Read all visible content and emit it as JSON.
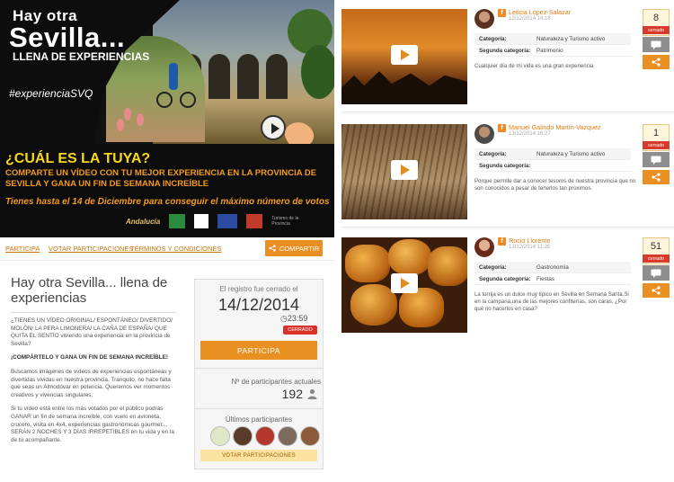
{
  "banner": {
    "line1": "Hay otra",
    "line2": "Sevilla...",
    "line3": "LLENA DE EXPERIENCIAS",
    "hashtag": "#experienciaSVQ",
    "question": "¿CUÁL ES LA TUYA?",
    "subtitle": "COMPARTE UN VÍDEO CON TU MEJOR EXPERIENCIA EN LA PROVINCIA DE SEVILLA Y GANA UN FIN DE SEMANA INCREÍBLE",
    "deadline": "Tienes hasta el 14 de Diciembre para conseguir el máximo número de votos",
    "logo_andalucia": "Andalucía",
    "logo_turismo": "Turismo de la Provincia"
  },
  "nav": {
    "participa": "PARTICIPA",
    "votar": "VOTAR PARTICIPACIONES",
    "terminos": "TÉRMINOS Y CONDICIONES",
    "compartir": "COMPARTIR"
  },
  "info": {
    "title": "Hay otra Sevilla... llena de experiencias",
    "p1": "¿TIENES UN VÍDEO ORIGINAL/ ESPONTÁNEO/ DIVERTIDO/ MOLÓN/ LA PERA LIMONERA/ LA CAÑA DE ESPAÑA/ QUE QUITA EL SENTÍO viviendo una experiencia en la provincia de Sevilla?",
    "p2": "¡COMPÁRTELO Y GANA UN FIN DE SEMANA INCREÍBLE!",
    "p3": "Buscamos imágenes de vídeos de experiencias espontáneas y divertidas vividas en nuestra provincia. Tranquilo, no hace falta que seas un Almodóvar en potencia. Queremos ver momentos creativos y vivencias singulares.",
    "p4": "Si tu vídeo está entre los más votados por el público podrás GANAR un fin de semana increíble, con vuelo en avioneta, crucero, visita en 4x4, experiencias gastronómicas gourmet… SERÁN 2 NOCHES Y 3 DÍAS IRREPETIBLES en tu vida y en la de tu acompañante."
  },
  "panel": {
    "reg_label": "El registro fue cerrado el",
    "reg_date": "14/12/2014",
    "reg_time": "23:59",
    "closed": "CERRADO",
    "participa": "PARTICIPA",
    "participants_label": "Nº de participantes actuales",
    "participants_count": "192",
    "last_label": "Últimos participantes",
    "votar": "VOTAR PARTICIPACIONES"
  },
  "entries": [
    {
      "name": "Leticia López-Salazar",
      "date": "12/12/2014 14:18",
      "cat_key": "Categoría:",
      "cat_val": "Naturaleza y Turismo activo",
      "sub_key": "Segunda categoría:",
      "sub_val": "Patrimonio",
      "desc": "Cualquier día de mi vida es una gran experiencia",
      "votes": "8",
      "closed": "cerrado"
    },
    {
      "name": "Manuel Galindo Martín-Vazquez",
      "date": "13/12/2014 16:27",
      "cat_key": "Categoría:",
      "cat_val": "Naturaleza y Turismo activo",
      "sub_key": "Segunda categoría:",
      "sub_val": "",
      "desc": "Porque permite dar a conocer tesoros de nuestra provincia que no son conocidos a pesar de tenerlos tan proximos.",
      "votes": "1",
      "closed": "cerrado"
    },
    {
      "name": "Rocio Llorente",
      "date": "13/12/2014 11:25",
      "cat_key": "Categoría:",
      "cat_val": "Gastronomía",
      "sub_key": "Segunda categoría:",
      "sub_val": "Fiestas",
      "desc": "La torrija es un dulce muy típico en Sevilla en Semana Santa.Si en la campana,una de las mejores confiterías, son caras. ¿Por qué no hacerlos en casa?",
      "votes": "51",
      "closed": "cerrado"
    }
  ],
  "colors": {
    "accent": "#ea8f23",
    "closed_red": "#d73b2b",
    "link": "#c9740a"
  }
}
